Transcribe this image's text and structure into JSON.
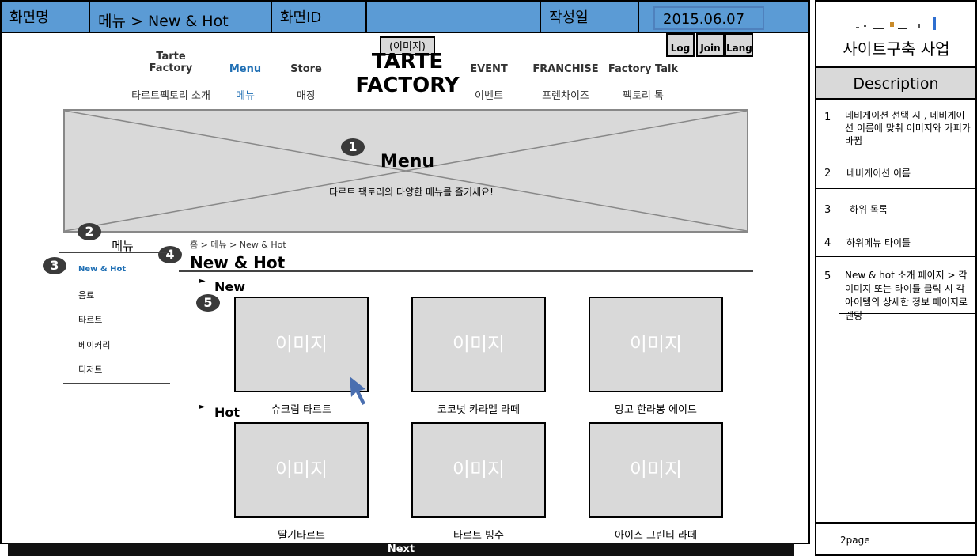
{
  "header": {
    "screen_name_label": "화면명",
    "screen_name_value": "메뉴 > New & Hot",
    "screen_id_label": "화면ID",
    "screen_id_value": "",
    "author_date_label": "작성일",
    "date_value": "2015.06.07"
  },
  "top_buttons": {
    "log": "Log",
    "join": "Join",
    "lang": "Lang"
  },
  "logo": {
    "image_tag": "(이미지)",
    "line1": "TARTE",
    "line2": "FACTORY"
  },
  "nav": {
    "items": [
      {
        "en": "Tarte Factory",
        "ko": "타르트팩토리 소개"
      },
      {
        "en": "Menu",
        "ko": "메뉴"
      },
      {
        "en": "Store",
        "ko": "매장"
      },
      {
        "en": "EVENT",
        "ko": "이벤트"
      },
      {
        "en": "FRANCHISE",
        "ko": "프렌차이즈"
      },
      {
        "en": "Factory Talk",
        "ko": "팩토리 톡"
      }
    ]
  },
  "banner": {
    "title": "Menu",
    "subtitle": "타르트 팩토리의 다양한 메뉴를 즐기세요!"
  },
  "badges": [
    "1",
    "2",
    "3",
    "4",
    "5"
  ],
  "sidebar": {
    "title": "메뉴",
    "items": [
      "New & Hot",
      "음료",
      "타르트",
      "베이커리",
      "디저트"
    ]
  },
  "content": {
    "breadcrumb": "홈 > 메뉴 > New & Hot",
    "title": "New & Hot",
    "arrow": "►",
    "sections": [
      {
        "label": "New",
        "items": [
          {
            "image": "이미지",
            "caption": "슈크림 타르트"
          },
          {
            "image": "이미지",
            "caption": "코코넛 캬라멜 라떼"
          },
          {
            "image": "이미지",
            "caption": "망고 한라봉 에이드"
          }
        ]
      },
      {
        "label": "Hot",
        "items": [
          {
            "image": "이미지",
            "caption": "딸기타르트"
          },
          {
            "image": "이미지",
            "caption": "타르트 빙수"
          },
          {
            "image": "이미지",
            "caption": "아이스 그린티 라떼"
          }
        ]
      }
    ]
  },
  "right_panel": {
    "project_title": "사이트구축 사업",
    "description_heading": "Description",
    "rows": [
      {
        "num": "1",
        "text": "네비게이션 선택 시 , 네비게이션 이름에 맞춰 이미지와 카피가 바뀜"
      },
      {
        "num": "2",
        "text": "네비게이션 이름"
      },
      {
        "num": "3",
        "text": "하위 목록"
      },
      {
        "num": "4",
        "text": "하위메뉴 타이틀"
      },
      {
        "num": "5",
        "text": "New & hot 소개 페이지 > 각 이미지 또는 타이틀 클릭 시 각 아이템의 상세한 정보 페이지로 랜딩"
      }
    ],
    "page_label": "2page"
  },
  "footer": {
    "next_label": "Next"
  },
  "colors": {
    "header_blue": "#5b9bd5",
    "active_blue": "#1f6fb4",
    "placeholder_gray": "#d9d9d9"
  }
}
